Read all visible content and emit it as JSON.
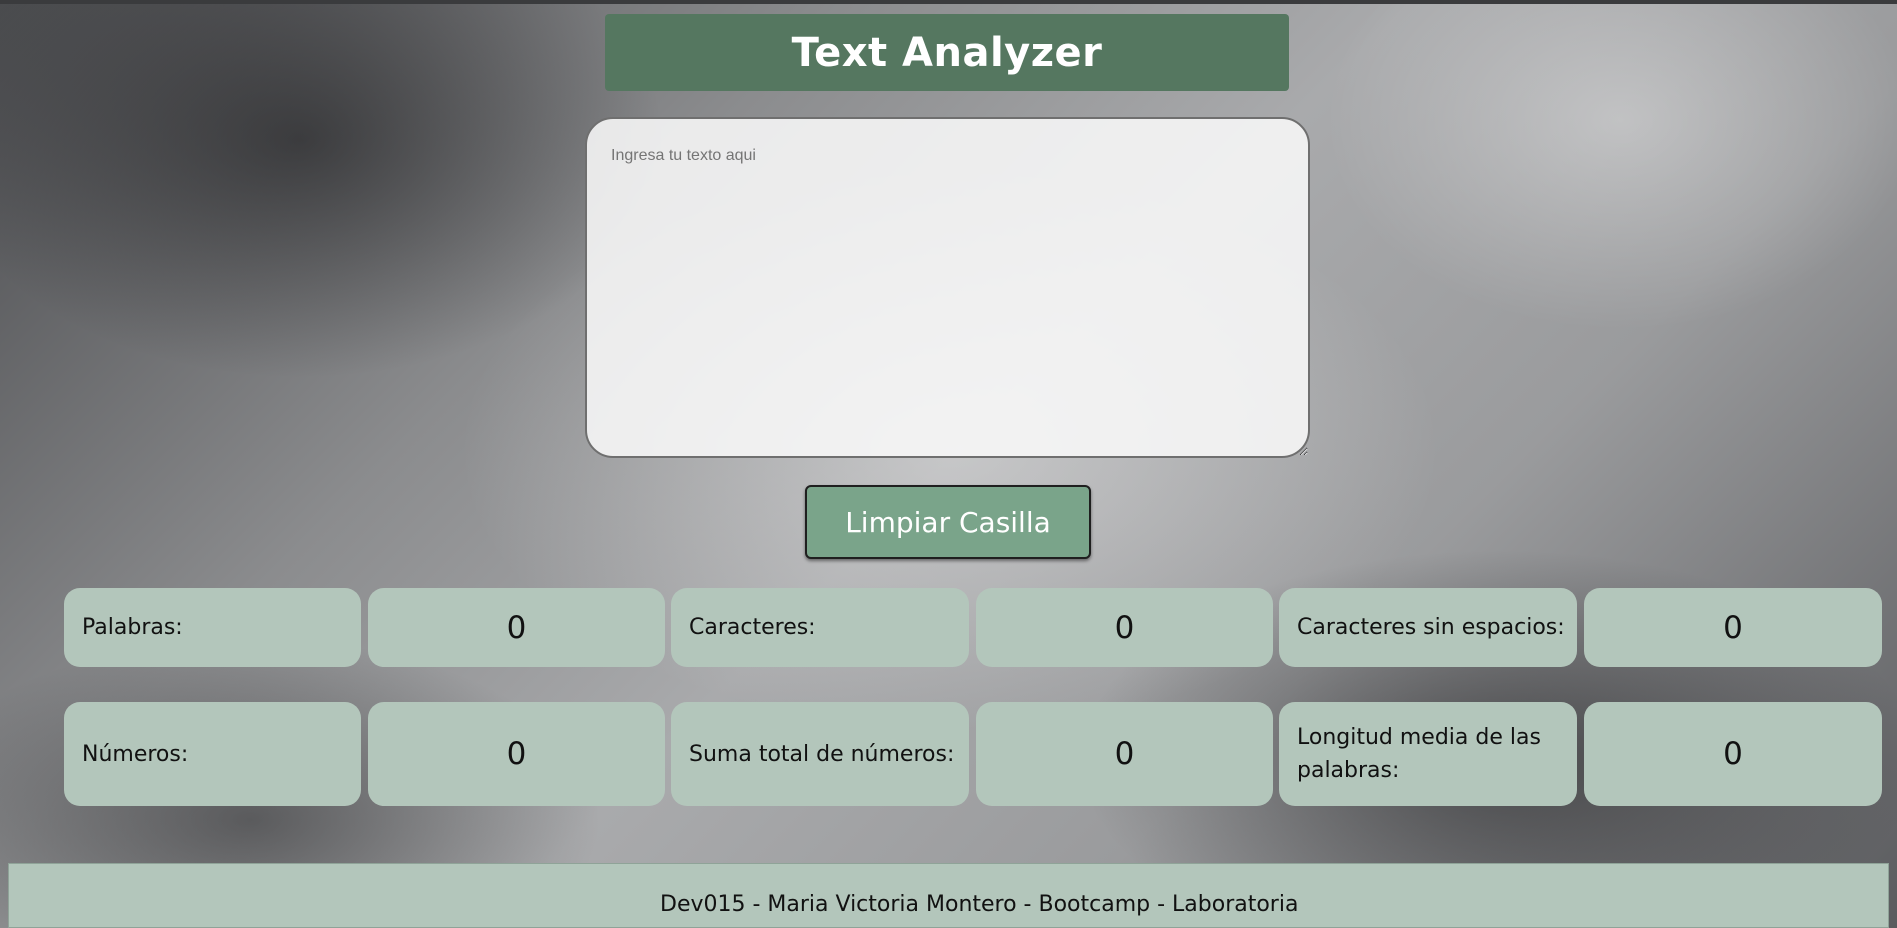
{
  "header": {
    "title": "Text Analyzer"
  },
  "input": {
    "placeholder": "Ingresa tu texto aqui",
    "value": ""
  },
  "clear_button": {
    "label": "Limpiar Casilla"
  },
  "stats": {
    "words": {
      "label": "Palabras:",
      "value": "0"
    },
    "characters": {
      "label": "Caracteres:",
      "value": "0"
    },
    "characters_no_spaces": {
      "label": "Caracteres sin espacios:",
      "value": "0"
    },
    "numbers": {
      "label": "Números:",
      "value": "0"
    },
    "numbers_sum": {
      "label": "Suma total de números:",
      "value": "0"
    },
    "avg_word_length": {
      "label": "Longitud media de las palabras:",
      "value": "0"
    }
  },
  "footer": {
    "text": "Dev015 - Maria Victoria Montero - Bootcamp - Laboratoria"
  },
  "colors": {
    "header_bg": "#557760",
    "button_bg": "#7aa48a",
    "card_bg": "#b3c6bb"
  }
}
